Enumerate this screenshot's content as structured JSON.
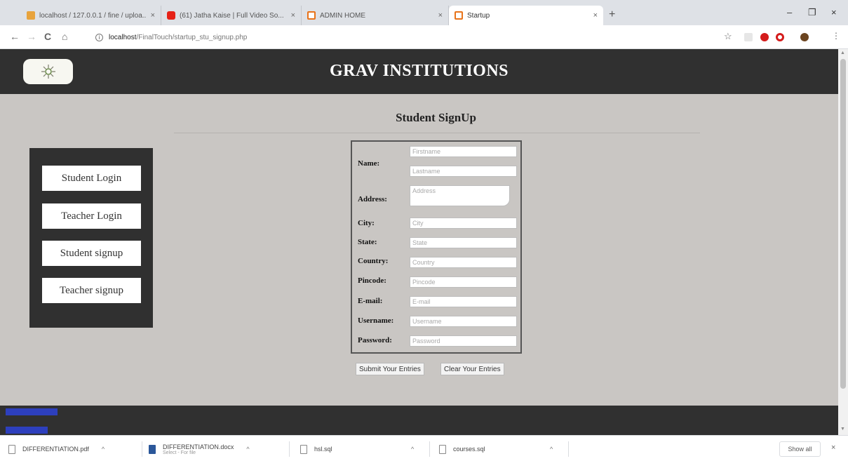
{
  "browser": {
    "tabs": [
      {
        "title": "localhost / 127.0.0.1 / fine / uploa..."
      },
      {
        "title": "(61) Jatha Kaise | Full Video So..."
      },
      {
        "title": "ADMIN HOME"
      },
      {
        "title": "Startup"
      }
    ],
    "new_tab_label": "+",
    "tab_close_label": "×",
    "window_controls": {
      "minimize": "–",
      "maximize": "❐",
      "close": "×"
    },
    "nav": {
      "back": "←",
      "forward": "→",
      "reload": "C",
      "home": "⌂"
    },
    "url_host": "localhost",
    "url_path": "/FinalTouch/startup_stu_signup.php",
    "info_label": "i",
    "bookmark_icon": "☆",
    "accent_colors": {
      "youtube": "#e62117",
      "opera": "#d41c1c",
      "tab_icon": "#e8731a"
    }
  },
  "page": {
    "site_title": "GRAV INSTITUTIONS",
    "form_title": "Student SignUp",
    "sidebar": {
      "items": [
        {
          "label": "Student Login"
        },
        {
          "label": "Teacher Login"
        },
        {
          "label": "Student signup"
        },
        {
          "label": "Teacher signup"
        }
      ]
    },
    "form": {
      "name_label": "Name:",
      "firstname_placeholder": "Firstname",
      "lastname_placeholder": "Lastname",
      "address_label": "Address:",
      "address_placeholder": "Address",
      "city_label": "City:",
      "city_placeholder": "City",
      "state_label": "State:",
      "state_placeholder": "State",
      "country_label": "Country:",
      "country_placeholder": "Country",
      "pincode_label": "Pincode:",
      "pincode_placeholder": "Pincode",
      "email_label": "E-mail:",
      "email_placeholder": "E-mail",
      "username_label": "Username:",
      "username_placeholder": "Username",
      "password_label": "Password:",
      "password_placeholder": "Password"
    },
    "actions": {
      "submit_label": "Submit Your Entries",
      "clear_label": "Clear Your Entries"
    },
    "colors": {
      "header_bg": "#303030",
      "page_bg": "#c9c6c3",
      "footer_link": "#2d3fbd"
    }
  },
  "downloads": {
    "items": [
      {
        "name": "DIFFERENTIATION.pdf",
        "sub": ""
      },
      {
        "name": "DIFFERENTIATION.docx",
        "sub": "Select - For file"
      },
      {
        "name": "hsl.sql",
        "sub": ""
      },
      {
        "name": "courses.sql",
        "sub": ""
      }
    ],
    "chevron": "^",
    "show_all_label": "Show all",
    "close_label": "×"
  }
}
